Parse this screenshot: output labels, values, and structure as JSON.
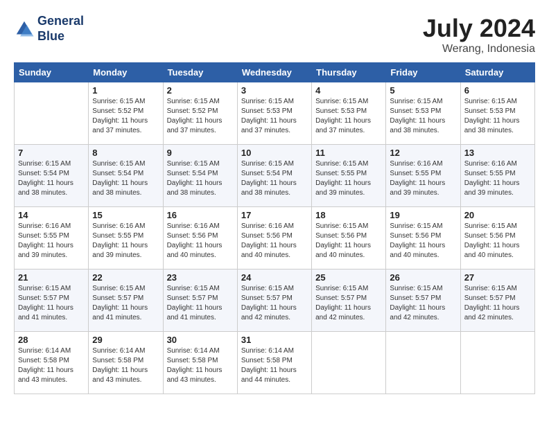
{
  "logo": {
    "line1": "General",
    "line2": "Blue"
  },
  "title": "July 2024",
  "location": "Werang, Indonesia",
  "weekdays": [
    "Sunday",
    "Monday",
    "Tuesday",
    "Wednesday",
    "Thursday",
    "Friday",
    "Saturday"
  ],
  "weeks": [
    [
      {
        "day": "",
        "sunrise": "",
        "sunset": "",
        "daylight": ""
      },
      {
        "day": "1",
        "sunrise": "Sunrise: 6:15 AM",
        "sunset": "Sunset: 5:52 PM",
        "daylight": "Daylight: 11 hours and 37 minutes."
      },
      {
        "day": "2",
        "sunrise": "Sunrise: 6:15 AM",
        "sunset": "Sunset: 5:52 PM",
        "daylight": "Daylight: 11 hours and 37 minutes."
      },
      {
        "day": "3",
        "sunrise": "Sunrise: 6:15 AM",
        "sunset": "Sunset: 5:53 PM",
        "daylight": "Daylight: 11 hours and 37 minutes."
      },
      {
        "day": "4",
        "sunrise": "Sunrise: 6:15 AM",
        "sunset": "Sunset: 5:53 PM",
        "daylight": "Daylight: 11 hours and 37 minutes."
      },
      {
        "day": "5",
        "sunrise": "Sunrise: 6:15 AM",
        "sunset": "Sunset: 5:53 PM",
        "daylight": "Daylight: 11 hours and 38 minutes."
      },
      {
        "day": "6",
        "sunrise": "Sunrise: 6:15 AM",
        "sunset": "Sunset: 5:53 PM",
        "daylight": "Daylight: 11 hours and 38 minutes."
      }
    ],
    [
      {
        "day": "7",
        "sunrise": "Sunrise: 6:15 AM",
        "sunset": "Sunset: 5:54 PM",
        "daylight": "Daylight: 11 hours and 38 minutes."
      },
      {
        "day": "8",
        "sunrise": "Sunrise: 6:15 AM",
        "sunset": "Sunset: 5:54 PM",
        "daylight": "Daylight: 11 hours and 38 minutes."
      },
      {
        "day": "9",
        "sunrise": "Sunrise: 6:15 AM",
        "sunset": "Sunset: 5:54 PM",
        "daylight": "Daylight: 11 hours and 38 minutes."
      },
      {
        "day": "10",
        "sunrise": "Sunrise: 6:15 AM",
        "sunset": "Sunset: 5:54 PM",
        "daylight": "Daylight: 11 hours and 38 minutes."
      },
      {
        "day": "11",
        "sunrise": "Sunrise: 6:15 AM",
        "sunset": "Sunset: 5:55 PM",
        "daylight": "Daylight: 11 hours and 39 minutes."
      },
      {
        "day": "12",
        "sunrise": "Sunrise: 6:16 AM",
        "sunset": "Sunset: 5:55 PM",
        "daylight": "Daylight: 11 hours and 39 minutes."
      },
      {
        "day": "13",
        "sunrise": "Sunrise: 6:16 AM",
        "sunset": "Sunset: 5:55 PM",
        "daylight": "Daylight: 11 hours and 39 minutes."
      }
    ],
    [
      {
        "day": "14",
        "sunrise": "Sunrise: 6:16 AM",
        "sunset": "Sunset: 5:55 PM",
        "daylight": "Daylight: 11 hours and 39 minutes."
      },
      {
        "day": "15",
        "sunrise": "Sunrise: 6:16 AM",
        "sunset": "Sunset: 5:55 PM",
        "daylight": "Daylight: 11 hours and 39 minutes."
      },
      {
        "day": "16",
        "sunrise": "Sunrise: 6:16 AM",
        "sunset": "Sunset: 5:56 PM",
        "daylight": "Daylight: 11 hours and 40 minutes."
      },
      {
        "day": "17",
        "sunrise": "Sunrise: 6:16 AM",
        "sunset": "Sunset: 5:56 PM",
        "daylight": "Daylight: 11 hours and 40 minutes."
      },
      {
        "day": "18",
        "sunrise": "Sunrise: 6:15 AM",
        "sunset": "Sunset: 5:56 PM",
        "daylight": "Daylight: 11 hours and 40 minutes."
      },
      {
        "day": "19",
        "sunrise": "Sunrise: 6:15 AM",
        "sunset": "Sunset: 5:56 PM",
        "daylight": "Daylight: 11 hours and 40 minutes."
      },
      {
        "day": "20",
        "sunrise": "Sunrise: 6:15 AM",
        "sunset": "Sunset: 5:56 PM",
        "daylight": "Daylight: 11 hours and 40 minutes."
      }
    ],
    [
      {
        "day": "21",
        "sunrise": "Sunrise: 6:15 AM",
        "sunset": "Sunset: 5:57 PM",
        "daylight": "Daylight: 11 hours and 41 minutes."
      },
      {
        "day": "22",
        "sunrise": "Sunrise: 6:15 AM",
        "sunset": "Sunset: 5:57 PM",
        "daylight": "Daylight: 11 hours and 41 minutes."
      },
      {
        "day": "23",
        "sunrise": "Sunrise: 6:15 AM",
        "sunset": "Sunset: 5:57 PM",
        "daylight": "Daylight: 11 hours and 41 minutes."
      },
      {
        "day": "24",
        "sunrise": "Sunrise: 6:15 AM",
        "sunset": "Sunset: 5:57 PM",
        "daylight": "Daylight: 11 hours and 42 minutes."
      },
      {
        "day": "25",
        "sunrise": "Sunrise: 6:15 AM",
        "sunset": "Sunset: 5:57 PM",
        "daylight": "Daylight: 11 hours and 42 minutes."
      },
      {
        "day": "26",
        "sunrise": "Sunrise: 6:15 AM",
        "sunset": "Sunset: 5:57 PM",
        "daylight": "Daylight: 11 hours and 42 minutes."
      },
      {
        "day": "27",
        "sunrise": "Sunrise: 6:15 AM",
        "sunset": "Sunset: 5:57 PM",
        "daylight": "Daylight: 11 hours and 42 minutes."
      }
    ],
    [
      {
        "day": "28",
        "sunrise": "Sunrise: 6:14 AM",
        "sunset": "Sunset: 5:58 PM",
        "daylight": "Daylight: 11 hours and 43 minutes."
      },
      {
        "day": "29",
        "sunrise": "Sunrise: 6:14 AM",
        "sunset": "Sunset: 5:58 PM",
        "daylight": "Daylight: 11 hours and 43 minutes."
      },
      {
        "day": "30",
        "sunrise": "Sunrise: 6:14 AM",
        "sunset": "Sunset: 5:58 PM",
        "daylight": "Daylight: 11 hours and 43 minutes."
      },
      {
        "day": "31",
        "sunrise": "Sunrise: 6:14 AM",
        "sunset": "Sunset: 5:58 PM",
        "daylight": "Daylight: 11 hours and 44 minutes."
      },
      {
        "day": "",
        "sunrise": "",
        "sunset": "",
        "daylight": ""
      },
      {
        "day": "",
        "sunrise": "",
        "sunset": "",
        "daylight": ""
      },
      {
        "day": "",
        "sunrise": "",
        "sunset": "",
        "daylight": ""
      }
    ]
  ]
}
